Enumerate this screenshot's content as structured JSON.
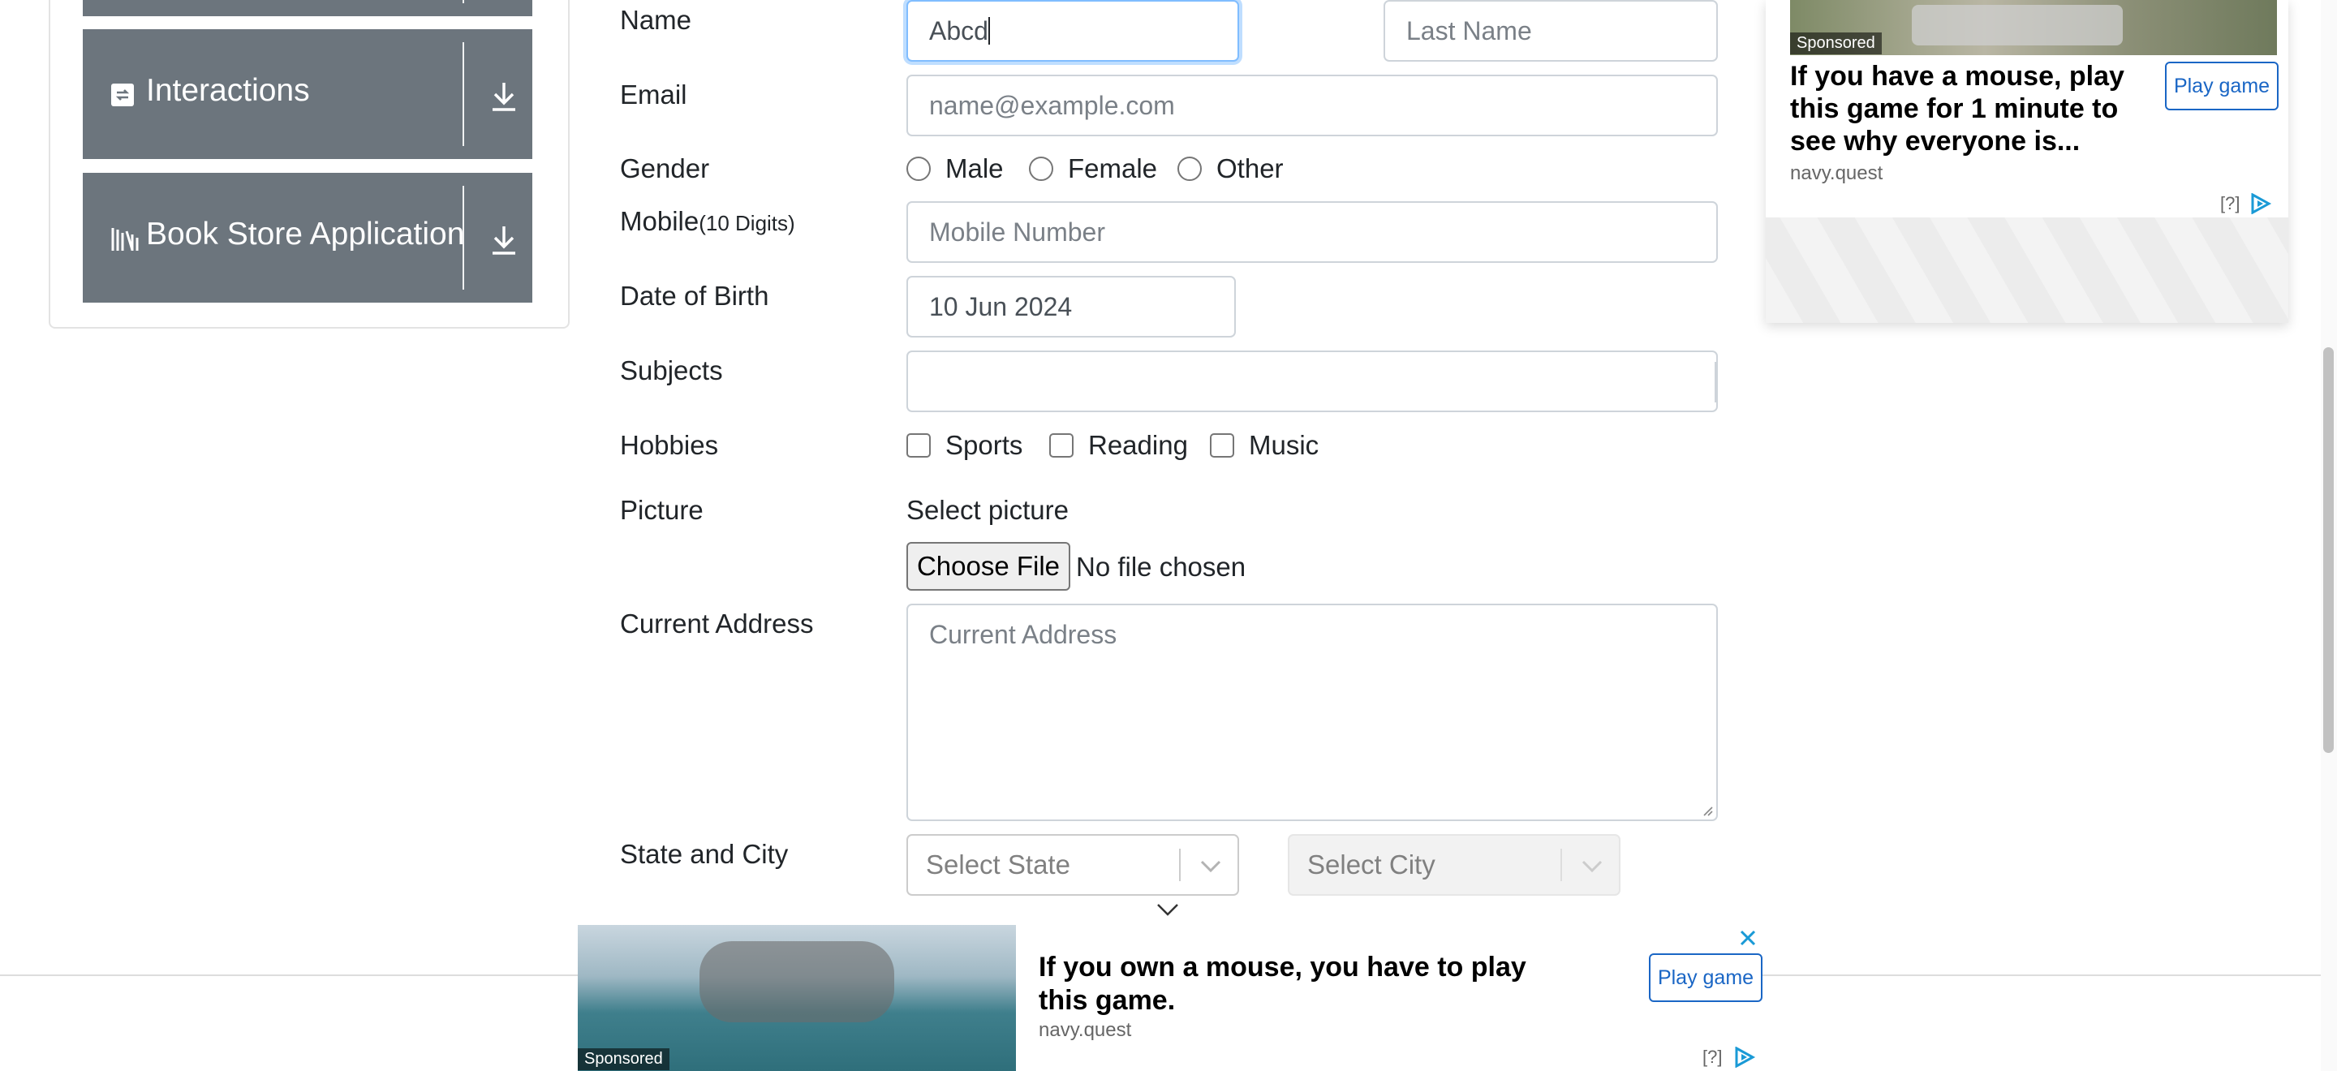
{
  "sidebar": {
    "items": [
      {
        "label": "Interactions",
        "icon": "interactions-icon"
      },
      {
        "label": "Book Store Application",
        "icon": "book-store-icon"
      }
    ]
  },
  "form": {
    "name_label": "Name",
    "first_name_value": "Abcd",
    "last_name_placeholder": "Last Name",
    "email_label": "Email",
    "email_placeholder": "name@example.com",
    "gender_label": "Gender",
    "gender_options": [
      "Male",
      "Female",
      "Other"
    ],
    "mobile_label": "Mobile",
    "mobile_hint": "(10 Digits)",
    "mobile_placeholder": "Mobile Number",
    "dob_label": "Date of Birth",
    "dob_value": "10 Jun 2024",
    "subjects_label": "Subjects",
    "hobbies_label": "Hobbies",
    "hobbies_options": [
      "Sports",
      "Reading",
      "Music"
    ],
    "picture_label": "Picture",
    "picture_select_text": "Select picture",
    "choose_file_label": "Choose File",
    "no_file_text": "No file chosen",
    "address_label": "Current Address",
    "address_placeholder": "Current Address",
    "state_city_label": "State and City",
    "state_placeholder": "Select State",
    "city_placeholder": "Select City"
  },
  "ad_right": {
    "sponsored": "Sponsored",
    "headline": "If you have a mouse, play this game for 1 minute to see why everyone is...",
    "source": "navy.quest",
    "cta": "Play game",
    "info": "[?]"
  },
  "ad_bottom": {
    "sponsored": "Sponsored",
    "headline": "If you own a mouse, you have to play this game.",
    "source": "navy.quest",
    "cta": "Play game",
    "info": "[?]"
  },
  "colors": {
    "sidebar_button": "#6c757d",
    "focus_border": "#80bdff",
    "ad_link": "#1a66c5"
  }
}
